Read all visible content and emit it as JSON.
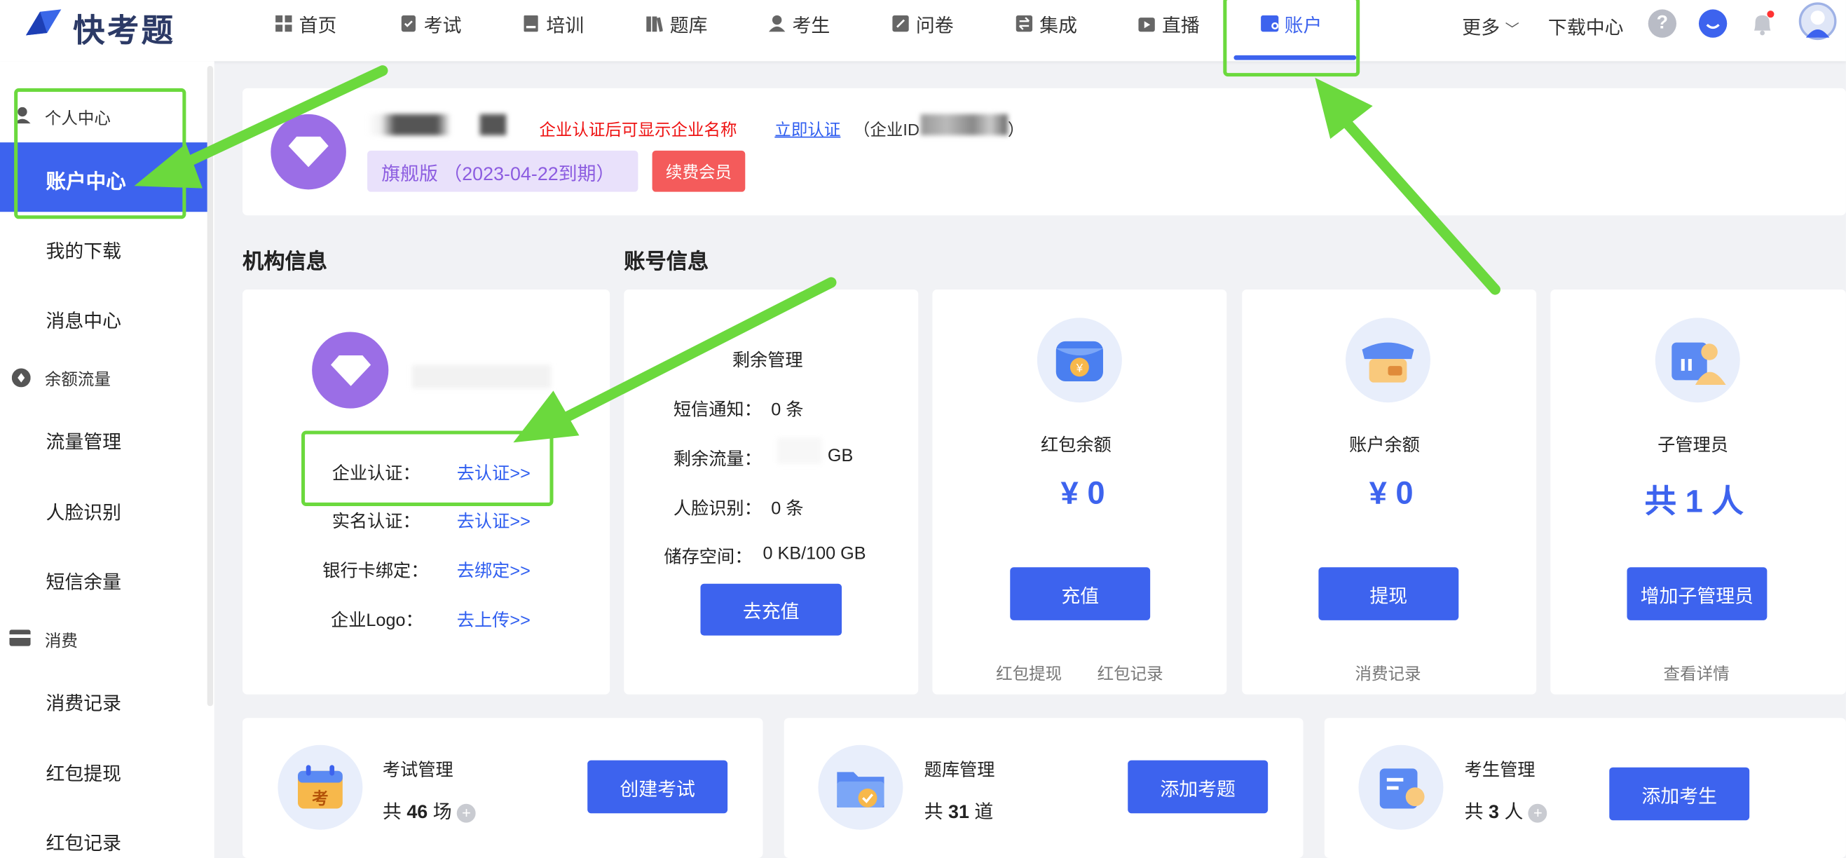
{
  "app": {
    "name": "快考题"
  },
  "nav": [
    {
      "label": "首页",
      "icon": "grid-icon"
    },
    {
      "label": "考试",
      "icon": "exam-icon"
    },
    {
      "label": "培训",
      "icon": "training-icon"
    },
    {
      "label": "题库",
      "icon": "books-icon"
    },
    {
      "label": "考生",
      "icon": "user-icon"
    },
    {
      "label": "问卷",
      "icon": "survey-icon"
    },
    {
      "label": "集成",
      "icon": "integration-icon"
    },
    {
      "label": "直播",
      "icon": "live-icon"
    },
    {
      "label": "账户",
      "icon": "wallet-icon"
    }
  ],
  "topright": {
    "more": "更多",
    "download_center": "下载中心"
  },
  "sidebar": {
    "group1": "个人中心",
    "account_center": "账户中心",
    "my_downloads": "我的下载",
    "messages": "消息中心",
    "group2": "余额流量",
    "traffic_mgmt": "流量管理",
    "face_id": "人脸识别",
    "sms_balance": "短信余量",
    "group3": "消费",
    "consume_records": "消费记录",
    "redpacket_withdraw": "红包提现",
    "redpacket_records": "红包记录"
  },
  "header": {
    "cert_notice": "企业认证后可显示企业名称",
    "cert_now": "立即认证",
    "company_id_prefix": "（企业ID",
    "company_id_suffix": "）",
    "plan": "旗舰版 （2023-04-22到期）",
    "renew": "续费会员"
  },
  "sections": {
    "org_info": "机构信息",
    "account_info": "账号信息"
  },
  "org": {
    "rows": [
      {
        "label": "企业认证：",
        "action": "去认证>>"
      },
      {
        "label": "实名认证：",
        "action": "去认证>>"
      },
      {
        "label": "银行卡绑定：",
        "action": "去绑定>>"
      },
      {
        "label": "企业Logo：",
        "action": "去上传>>"
      }
    ]
  },
  "remaining": {
    "title": "剩余管理",
    "sms_label": "短信通知：",
    "sms_value": "0 条",
    "traffic_label": "剩余流量：",
    "traffic_unit": "GB",
    "face_label": "人脸识别：",
    "face_value": "0 条",
    "storage_label": "储存空间：",
    "storage_value": "0 KB/100 GB",
    "recharge_btn": "去充值"
  },
  "redpacket": {
    "title": "红包余额",
    "value": "¥ 0",
    "btn": "充值",
    "link1": "红包提现",
    "link2": "红包记录"
  },
  "account_balance": {
    "title": "账户余额",
    "value": "¥ 0",
    "btn": "提现",
    "link": "消费记录"
  },
  "sub_admin": {
    "title": "子管理员",
    "value": "共 1 人",
    "btn": "增加子管理员",
    "link": "查看详情"
  },
  "features": [
    {
      "title": "考试管理",
      "prefix": "共",
      "count": "46",
      "unit": "场",
      "btn": "创建考试"
    },
    {
      "title": "题库管理",
      "prefix": "共",
      "count": "31",
      "unit": "道",
      "btn": "添加考题"
    },
    {
      "title": "考生管理",
      "prefix": "共",
      "count": "3",
      "unit": "人",
      "btn": "添加考生"
    }
  ],
  "colors": {
    "accent": "#3d63ee",
    "highlight": "#6bd93d",
    "warning": "#e11",
    "purple": "#9b6ee6"
  }
}
